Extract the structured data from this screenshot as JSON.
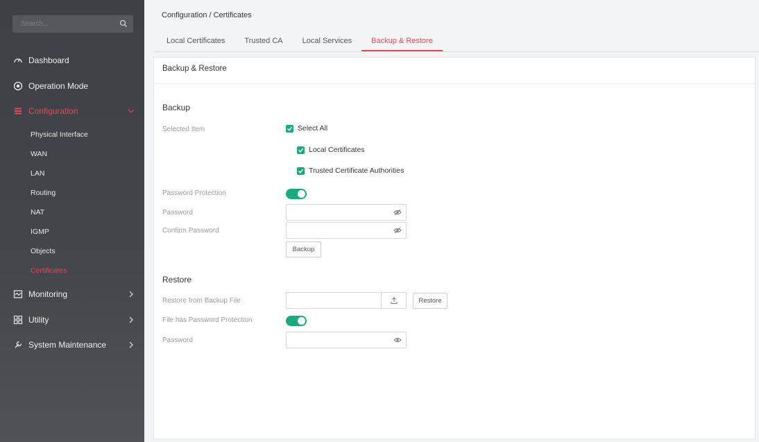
{
  "sidebar": {
    "search_placeholder": "Search...",
    "items": [
      {
        "label": "Dashboard",
        "icon": "dashboard-icon"
      },
      {
        "label": "Operation Mode",
        "icon": "operation-mode-icon"
      },
      {
        "label": "Configuration",
        "icon": "configuration-icon",
        "active": true,
        "expanded": true
      },
      {
        "label": "Monitoring",
        "icon": "monitoring-icon"
      },
      {
        "label": "Utility",
        "icon": "utility-icon"
      },
      {
        "label": "System Maintenance",
        "icon": "wrench-icon"
      }
    ],
    "sub_items": [
      "Physical Interface",
      "WAN",
      "LAN",
      "Routing",
      "NAT",
      "IGMP",
      "Objects",
      "Certificates"
    ]
  },
  "breadcrumb": "Configuration / Certificates",
  "tabs": [
    {
      "label": "Local Certificates"
    },
    {
      "label": "Trusted CA"
    },
    {
      "label": "Local Services"
    },
    {
      "label": "Backup & Restore",
      "active": true
    }
  ],
  "panel": {
    "title": "Backup & Restore",
    "backup": {
      "title": "Backup",
      "selected_item_label": "Selected Item",
      "select_all": "Select All",
      "local_certificates": "Local Certificates",
      "trusted_cas": "Trusted Certificate Authorities",
      "password_protection_label": "Password Protection",
      "password_label": "Password",
      "confirm_password_label": "Confirm Password",
      "backup_button": "Backup"
    },
    "restore": {
      "title": "Restore",
      "restore_file_label": "Restore from Backup File",
      "restore_button": "Restore",
      "file_password_label": "File has Password Protection",
      "password_label": "Password"
    }
  },
  "colors": {
    "accent": "#e04a5a",
    "toggle_on": "#1aaa7e",
    "sidebar_bg": "#3d4045"
  }
}
